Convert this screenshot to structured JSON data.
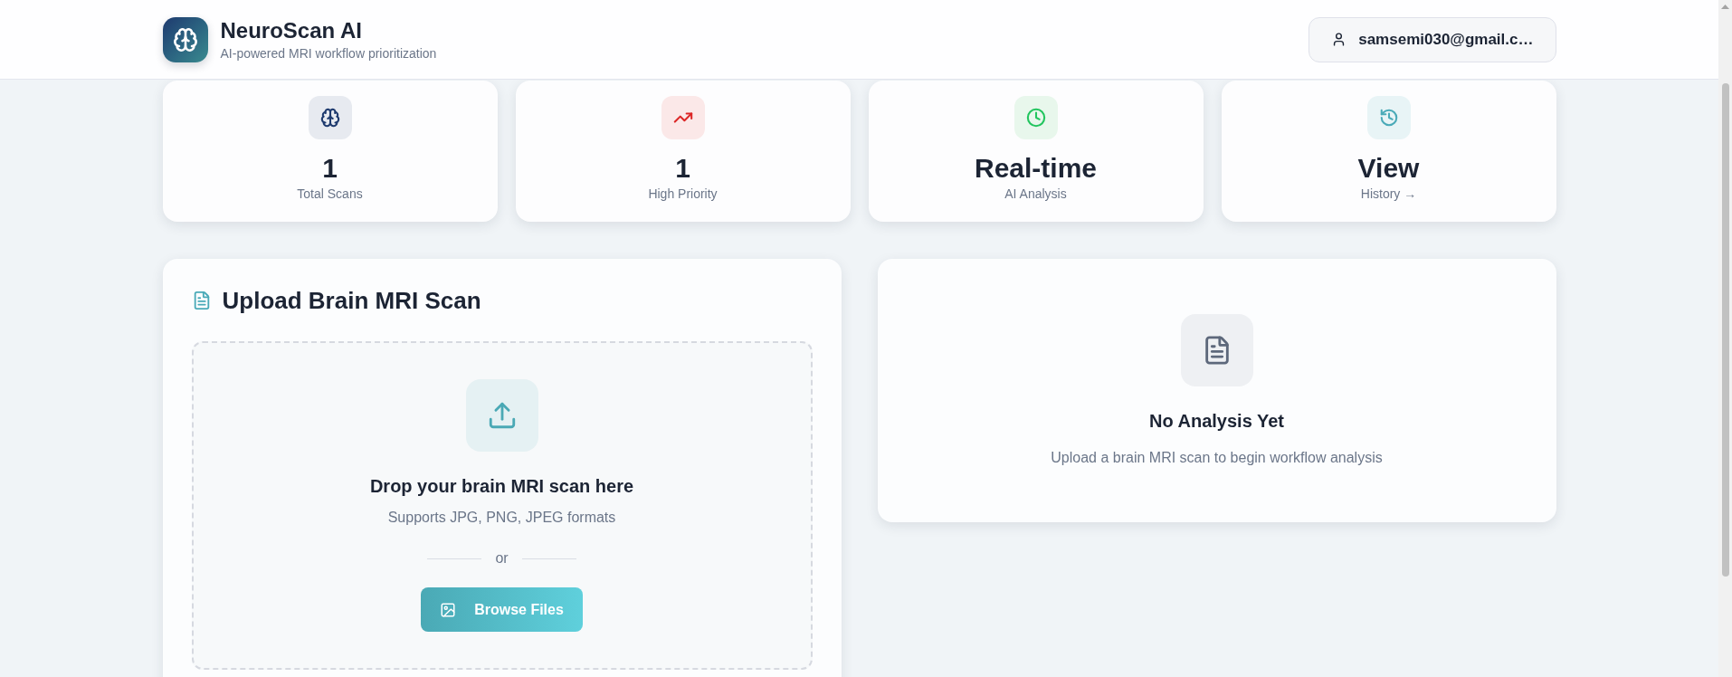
{
  "header": {
    "title": "NeuroScan AI",
    "subtitle": "AI-powered MRI workflow prioritization",
    "user_button": {
      "label": "samsemi030@gmail.c…"
    }
  },
  "stats": [
    {
      "value": "1",
      "label": "Total Scans"
    },
    {
      "value": "1",
      "label": "High Priority"
    },
    {
      "value": "Real-time",
      "label": "AI Analysis"
    },
    {
      "value": "View",
      "label": "History →"
    }
  ],
  "upload_panel": {
    "title": "Upload Brain MRI Scan",
    "dropzone": {
      "heading": "Drop your brain MRI scan here",
      "hint": "Supports JPG, PNG, JPEG formats",
      "divider": "or",
      "button": "Browse Files"
    }
  },
  "analysis_panel": {
    "title": "No Analysis Yet",
    "message": "Upload a brain MRI scan to begin workflow analysis"
  }
}
